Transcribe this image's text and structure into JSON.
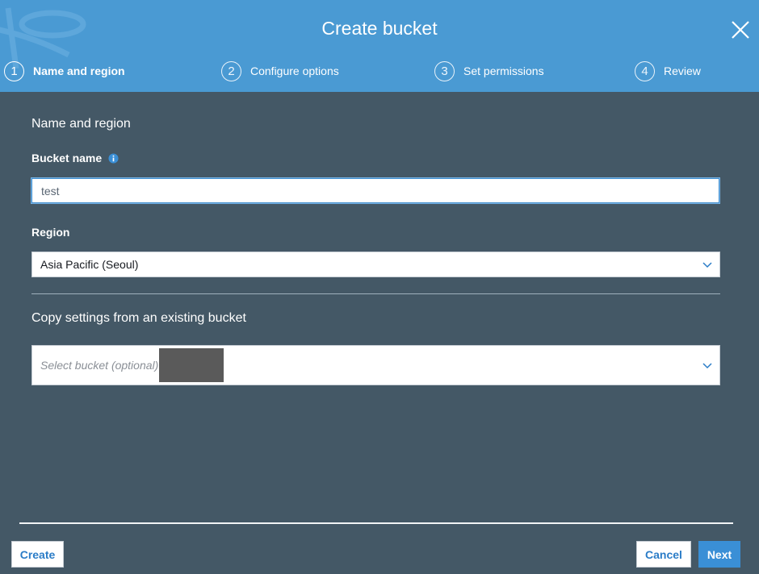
{
  "dialog": {
    "title": "Create bucket"
  },
  "steps": [
    {
      "number": "1",
      "label": "Name and region",
      "active": true
    },
    {
      "number": "2",
      "label": "Configure options",
      "active": false
    },
    {
      "number": "3",
      "label": "Set permissions",
      "active": false
    },
    {
      "number": "4",
      "label": "Review",
      "active": false
    }
  ],
  "form": {
    "section_title": "Name and region",
    "bucket_name_label": "Bucket name",
    "bucket_name_value": "test",
    "region_label": "Region",
    "region_value": "Asia Pacific (Seoul)",
    "copy_title": "Copy settings from an existing bucket",
    "copy_placeholder": "Select bucket (optional)"
  },
  "footer": {
    "create_label": "Create",
    "cancel_label": "Cancel",
    "next_label": "Next"
  },
  "colors": {
    "header": "#4a9ad3",
    "body": "#445866",
    "primary_button": "#3a8fd6",
    "link_text": "#2a7cc7"
  },
  "icons": {
    "close": "close-icon",
    "info": "info-icon",
    "dropdown": "chevron-down-icon"
  }
}
